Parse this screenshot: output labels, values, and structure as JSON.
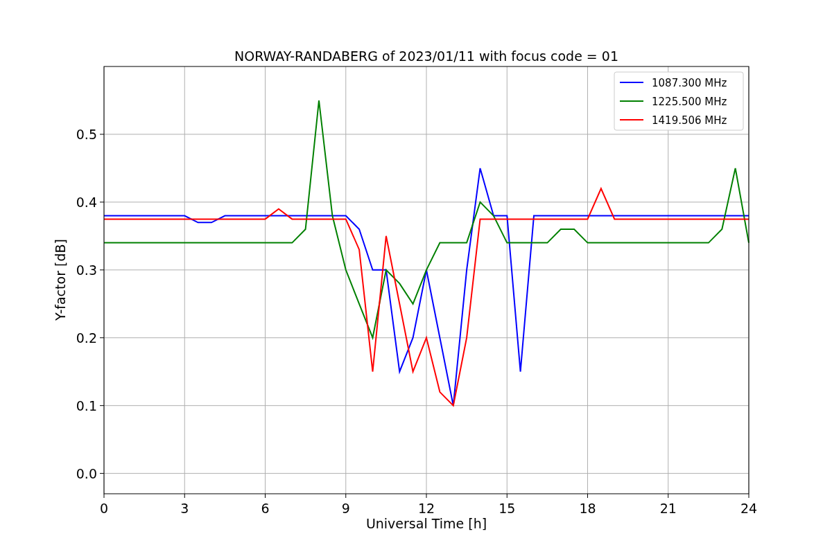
{
  "chart_data": {
    "type": "line",
    "title": "NORWAY-RANDABERG of 2023/01/11 with focus code = 01",
    "xlabel": "Universal Time [h]",
    "ylabel": "Y-factor [dB]",
    "x": [
      0,
      0.5,
      1,
      1.5,
      2,
      2.5,
      3,
      3.5,
      4,
      4.5,
      5,
      5.5,
      6,
      6.5,
      7,
      7.5,
      8,
      8.5,
      9,
      9.5,
      10,
      10.5,
      11,
      11.5,
      12,
      12.5,
      13,
      13.5,
      14,
      14.5,
      15,
      15.5,
      16,
      16.5,
      17,
      17.5,
      18,
      18.5,
      19,
      19.5,
      20,
      20.5,
      21,
      21.5,
      22,
      22.5,
      23,
      23.5,
      24
    ],
    "series": [
      {
        "name": "1087.300 MHz",
        "color": "#0000ff",
        "values": [
          0.38,
          0.38,
          0.38,
          0.38,
          0.38,
          0.38,
          0.38,
          0.37,
          0.37,
          0.38,
          0.38,
          0.38,
          0.38,
          0.38,
          0.38,
          0.38,
          0.38,
          0.38,
          0.38,
          0.36,
          0.3,
          0.3,
          0.15,
          0.2,
          0.3,
          0.2,
          0.1,
          0.3,
          0.45,
          0.38,
          0.38,
          0.15,
          0.38,
          0.38,
          0.38,
          0.38,
          0.38,
          0.38,
          0.38,
          0.38,
          0.38,
          0.38,
          0.38,
          0.38,
          0.38,
          0.38,
          0.38,
          0.38,
          0.38
        ]
      },
      {
        "name": "1225.500 MHz",
        "color": "#008000",
        "values": [
          0.34,
          0.34,
          0.34,
          0.34,
          0.34,
          0.34,
          0.34,
          0.34,
          0.34,
          0.34,
          0.34,
          0.34,
          0.34,
          0.34,
          0.34,
          0.36,
          0.55,
          0.38,
          0.3,
          0.25,
          0.2,
          0.3,
          0.28,
          0.25,
          0.3,
          0.34,
          0.34,
          0.34,
          0.4,
          0.38,
          0.34,
          0.34,
          0.34,
          0.34,
          0.36,
          0.36,
          0.34,
          0.34,
          0.34,
          0.34,
          0.34,
          0.34,
          0.34,
          0.34,
          0.34,
          0.34,
          0.36,
          0.45,
          0.34
        ]
      },
      {
        "name": "1419.506 MHz",
        "color": "#ff0000",
        "values": [
          0.375,
          0.375,
          0.375,
          0.375,
          0.375,
          0.375,
          0.375,
          0.375,
          0.375,
          0.375,
          0.375,
          0.375,
          0.375,
          0.39,
          0.375,
          0.375,
          0.375,
          0.375,
          0.375,
          0.33,
          0.15,
          0.35,
          0.25,
          0.15,
          0.2,
          0.12,
          0.1,
          0.2,
          0.375,
          0.375,
          0.375,
          0.375,
          0.375,
          0.375,
          0.375,
          0.375,
          0.375,
          0.42,
          0.375,
          0.375,
          0.375,
          0.375,
          0.375,
          0.375,
          0.375,
          0.375,
          0.375,
          0.375,
          0.375
        ]
      }
    ],
    "grid": true,
    "legend": true,
    "xlim": [
      0,
      24
    ],
    "ylim": [
      -0.03,
      0.6
    ],
    "xticks": [
      0,
      3,
      6,
      9,
      12,
      15,
      18,
      21,
      24
    ],
    "yticks": [
      {
        "value": 0,
        "label": "0.0"
      },
      {
        "value": 0.1,
        "label": "0.1"
      },
      {
        "value": 0.2,
        "label": "0.2"
      },
      {
        "value": 0.3,
        "label": "0.3"
      },
      {
        "value": 0.4,
        "label": "0.4"
      },
      {
        "value": 0.5,
        "label": "0.5"
      }
    ]
  }
}
